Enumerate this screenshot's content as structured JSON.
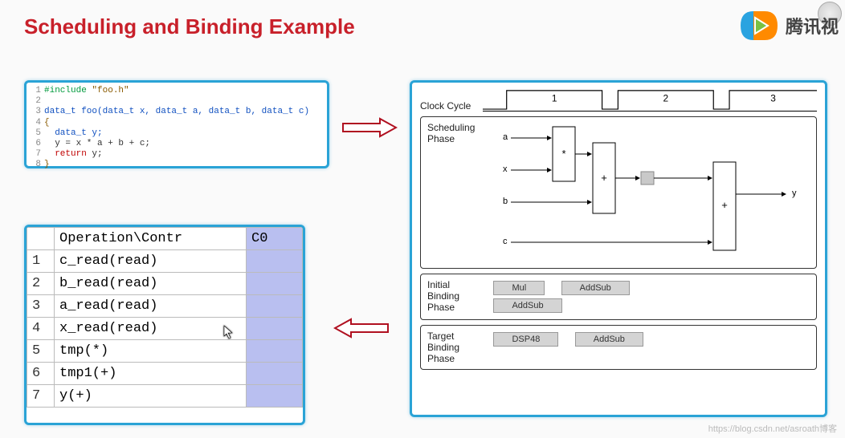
{
  "title": "Scheduling and Binding Example",
  "logo_text": "腾讯视",
  "watermark": "https://blog.csdn.net/asroath博客",
  "code": {
    "lines": [
      {
        "n": "1",
        "segs": [
          {
            "t": "#include ",
            "c": "kw-green"
          },
          {
            "t": "\"foo.h\"",
            "c": "kw-brown"
          }
        ]
      },
      {
        "n": "2",
        "segs": []
      },
      {
        "n": "3",
        "segs": [
          {
            "t": "data_t foo(data_t x, data_t a, data_t b, data_t c)",
            "c": "kw-blue"
          }
        ]
      },
      {
        "n": "4",
        "segs": [
          {
            "t": "{",
            "c": "kw-brown"
          }
        ]
      },
      {
        "n": "5",
        "segs": [
          {
            "t": "  data_t y;",
            "c": "kw-blue"
          }
        ]
      },
      {
        "n": "6",
        "segs": [
          {
            "t": "  y = x * a + b + c;",
            "c": ""
          }
        ]
      },
      {
        "n": "7",
        "segs": [
          {
            "t": "  ",
            "c": ""
          },
          {
            "t": "return",
            "c": "kw-red"
          },
          {
            "t": " y;",
            "c": ""
          }
        ]
      },
      {
        "n": "8",
        "segs": [
          {
            "t": "}",
            "c": "kw-brown"
          }
        ]
      }
    ]
  },
  "table": {
    "headers": [
      "",
      "Operation\\Contr",
      "C0"
    ],
    "rows": [
      {
        "n": "1",
        "op": "c_read(read)"
      },
      {
        "n": "2",
        "op": "b_read(read)"
      },
      {
        "n": "3",
        "op": "a_read(read)"
      },
      {
        "n": "4",
        "op": "x_read(read)"
      },
      {
        "n": "5",
        "op": "tmp(*)"
      },
      {
        "n": "6",
        "op": "tmp1(+)"
      },
      {
        "n": "7",
        "op": "y(+)"
      }
    ]
  },
  "diagram": {
    "clock_label": "Clock Cycle",
    "cycles": [
      "1",
      "2",
      "3"
    ],
    "sched_title": "Scheduling Phase",
    "signals": [
      "a",
      "x",
      "b",
      "c",
      "y"
    ],
    "ops": [
      "*",
      "+",
      "+"
    ],
    "initial_binding": {
      "title": "Initial Binding Phase",
      "items": [
        "Mul",
        "AddSub",
        "AddSub"
      ]
    },
    "target_binding": {
      "title": "Target Binding Phase",
      "items": [
        "DSP48",
        "AddSub"
      ]
    }
  }
}
